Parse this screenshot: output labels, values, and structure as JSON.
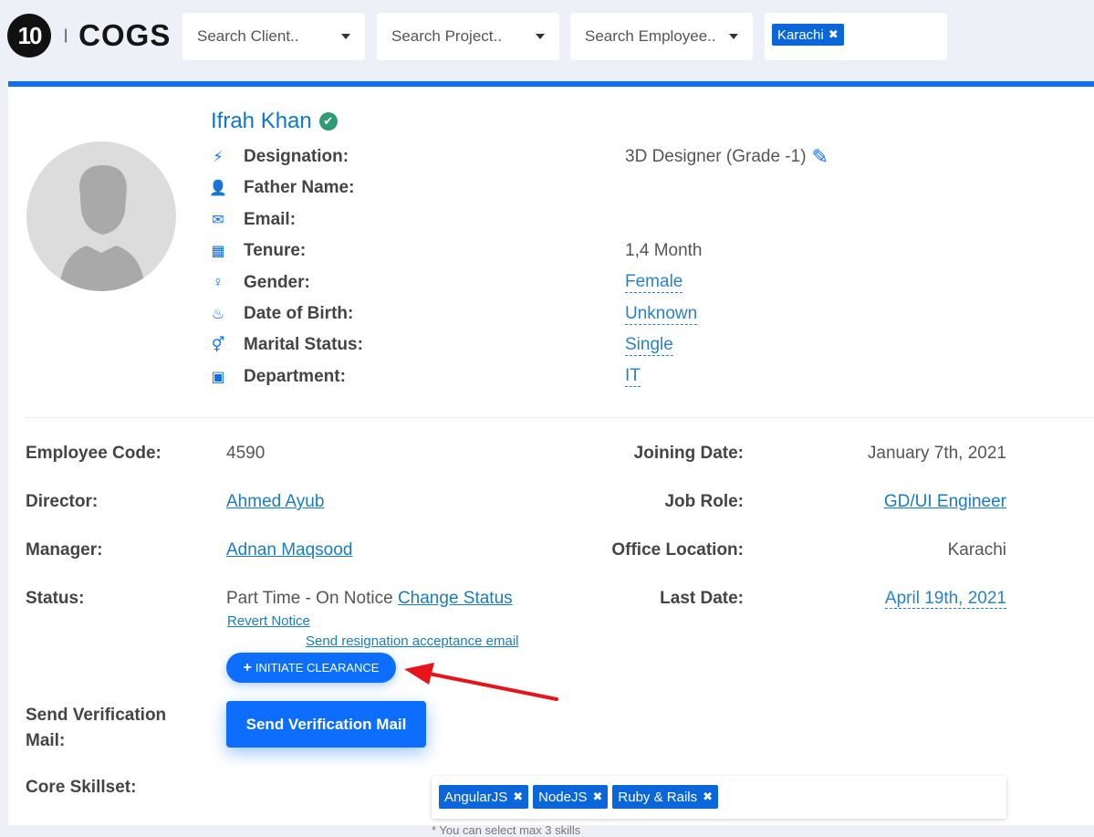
{
  "logo": {
    "mark": "10",
    "text": "COGS"
  },
  "filters": {
    "client_placeholder": "Search Client..",
    "project_placeholder": "Search Project..",
    "employee_placeholder": "Search Employee..",
    "location_tag": "Karachi"
  },
  "profile": {
    "name": "Ifrah Khan",
    "fields": [
      {
        "icon": "bolt-icon",
        "label": "Designation:",
        "value": "3D Designer (Grade -1)"
      },
      {
        "icon": "user-icon",
        "label": "Father Name:",
        "value": ""
      },
      {
        "icon": "envelope-icon",
        "label": "Email:",
        "value": ""
      },
      {
        "icon": "calendar-icon",
        "label": "Tenure:",
        "value": "1,4 Month"
      },
      {
        "icon": "venus-icon",
        "label": "Gender:",
        "value": "Female"
      },
      {
        "icon": "birthday-cake-icon",
        "label": "Date of Birth:",
        "value": "Unknown"
      },
      {
        "icon": "venus-mars-icon",
        "label": "Marital Status:",
        "value": "Single"
      },
      {
        "icon": "department-icon",
        "label": "Department:",
        "value": "IT"
      }
    ]
  },
  "details": {
    "employee_code_label": "Employee Code:",
    "employee_code": "4590",
    "joining_date_label": "Joining Date:",
    "joining_date": "January 7th, 2021",
    "director_label": "Director:",
    "director": "Ahmed Ayub",
    "job_role_label": "Job Role:",
    "job_role": "GD/UI Engineer",
    "manager_label": "Manager:",
    "manager": "Adnan Maqsood",
    "office_location_label": "Office Location:",
    "office_location": "Karachi",
    "status_label": "Status:",
    "status": "Part Time - On Notice",
    "change_status": "Change Status",
    "last_date_label": "Last Date:",
    "last_date": "April 19th, 2021",
    "revert_notice": "Revert Notice",
    "resignation_email": "Send resignation acceptance email",
    "initiate_clearance": "INITIATE CLEARANCE",
    "send_verification_label": "Send Verification Mail:",
    "send_verification_button": "Send Verification Mail",
    "core_skillset_label": "Core Skillset:",
    "skills": [
      "AngularJS",
      "NodeJS",
      "Ruby & Rails"
    ],
    "skills_hint": "* You can select max 3 skills"
  },
  "colors": {
    "primary": "#0d6efd",
    "link": "#1a7cbf",
    "verified": "#2f9b74",
    "arrow": "#e8141c"
  }
}
